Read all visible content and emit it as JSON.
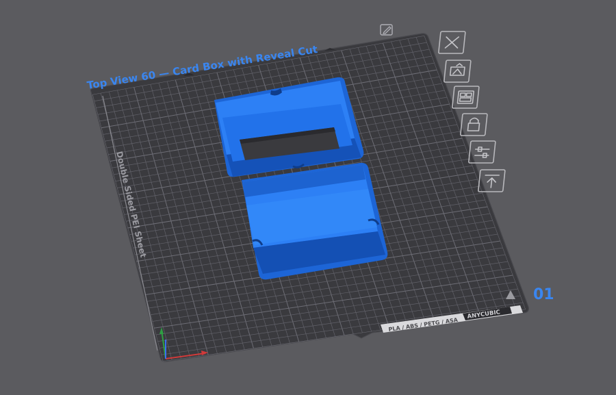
{
  "plate": {
    "name": "Top View 60 — Card Box with Reveal Cut",
    "number": "01",
    "sheet_label": "Double Sided PEI Sheet",
    "materials": "PLA / ABS / PETG / ASA",
    "brand": "ANYCUBIC"
  },
  "toolbar": [
    {
      "id": "delete",
      "icon": "close-icon"
    },
    {
      "id": "add-object",
      "icon": "add-object-icon"
    },
    {
      "id": "arrange",
      "icon": "arrange-icon"
    },
    {
      "id": "lock",
      "icon": "lock-icon"
    },
    {
      "id": "settings",
      "icon": "slider-settings-icon"
    },
    {
      "id": "move-to-top",
      "icon": "align-top-icon"
    }
  ],
  "colors": {
    "background": "#5b5b5f",
    "plate": "#38383c",
    "model": "#1f6fe0",
    "accent_text": "#3a86f0"
  }
}
